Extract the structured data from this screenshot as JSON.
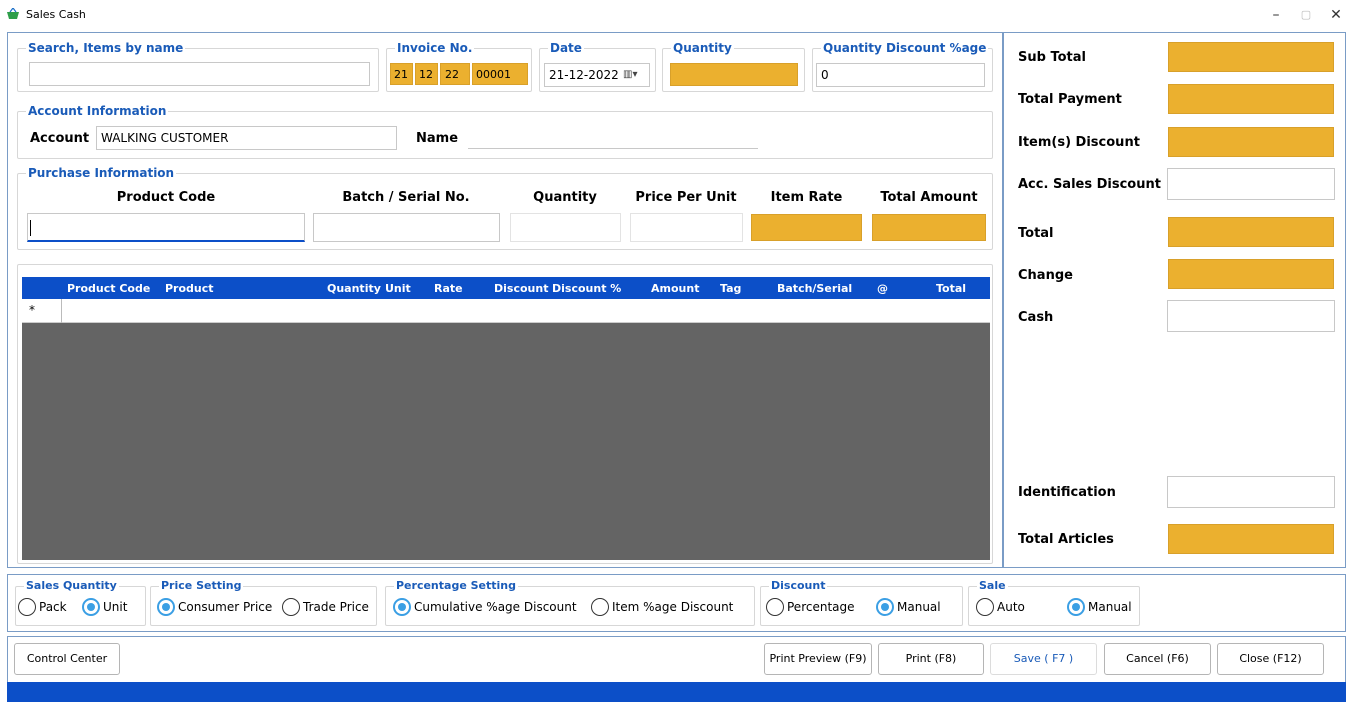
{
  "window": {
    "title": "Sales Cash",
    "minimize": "–",
    "maximize": "▢",
    "close": "✕"
  },
  "top": {
    "search": {
      "label": "Search, Items by name",
      "value": ""
    },
    "invoice": {
      "label": "Invoice No.",
      "parts": [
        "21",
        "12",
        "22",
        "00001"
      ]
    },
    "date": {
      "label": "Date",
      "value": "21-12-2022"
    },
    "quantity": {
      "label": "Quantity",
      "value": ""
    },
    "qty_discount": {
      "label": "Quantity Discount %age",
      "value": "0"
    }
  },
  "account": {
    "section": "Account Information",
    "account_label": "Account",
    "account_value": "WALKING CUSTOMER",
    "name_label": "Name",
    "name_value": ""
  },
  "purchase": {
    "section": "Purchase Information",
    "headers": [
      "Product Code",
      "Batch / Serial No.",
      "Quantity",
      "Price Per Unit",
      "Item Rate",
      "Total Amount"
    ]
  },
  "grid": {
    "columns": [
      "Product Code",
      "Product",
      "Quantity",
      "Unit",
      "Rate",
      "Discount",
      "Discount %",
      "Amount",
      "Tag",
      "Batch/Serial",
      "@",
      "Total"
    ],
    "new_row_marker": "*"
  },
  "summary": {
    "sub_total": "Sub Total",
    "total_payment": "Total Payment",
    "item_discount": "Item(s) Discount",
    "acc_sales_discount": "Acc. Sales Discount",
    "total": "Total",
    "change": "Change",
    "cash": "Cash",
    "identification": "Identification",
    "total_articles": "Total Articles"
  },
  "options": {
    "sales_quantity": {
      "label": "Sales Quantity",
      "opts": [
        "Pack",
        "Unit"
      ],
      "selected": "Unit"
    },
    "price_setting": {
      "label": "Price Setting",
      "opts": [
        "Consumer Price",
        "Trade Price"
      ],
      "selected": "Consumer Price"
    },
    "percentage_setting": {
      "label": "Percentage Setting",
      "opts": [
        "Cumulative %age Discount",
        "Item %age Discount"
      ],
      "selected": "Cumulative %age Discount"
    },
    "discount": {
      "label": "Discount",
      "opts": [
        "Percentage",
        "Manual"
      ],
      "selected": "Manual"
    },
    "sale": {
      "label": "Sale",
      "opts": [
        "Auto",
        "Manual"
      ],
      "selected": "Manual"
    }
  },
  "buttons": {
    "control_center": "Control Center",
    "print_preview": "Print Preview (F9)",
    "print": "Print (F8)",
    "save": "Save ( F7 )",
    "cancel": "Cancel (F6)",
    "close": "Close (F12)"
  },
  "colors": {
    "accent": "#0c4fc8",
    "highlight": "#ebb02f",
    "grid_bg": "#646464",
    "label_blue": "#1a5bb8"
  }
}
